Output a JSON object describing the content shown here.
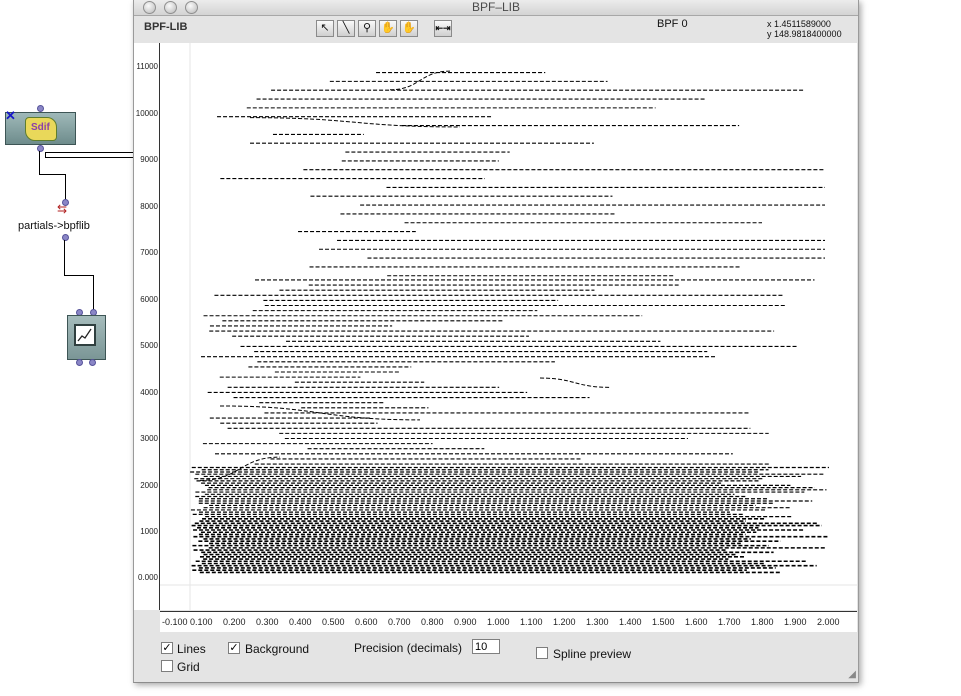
{
  "window": {
    "title": "BPF–LIB",
    "library_label": "BPF-LIB",
    "bpf_name": "BPF 0",
    "cursor_x": "x 1.4511589000",
    "cursor_y": "y 148.9818400000"
  },
  "toolbar": {
    "tools": [
      "arrow-select-icon",
      "pencil-draw-icon",
      "zoom-icon",
      "hand-move-icon",
      "hand-scroll-icon",
      "fit-width-icon"
    ]
  },
  "patch": {
    "box_label": "partials->bpflib",
    "sdif_icon_text": "Sdif"
  },
  "chart_data": {
    "type": "line",
    "description_free": true,
    "y_ticks": [
      "11000",
      "10000",
      "9000",
      "8000",
      "7000",
      "6000",
      "5000",
      "4000",
      "3000",
      "2000",
      "1000",
      "0.000"
    ],
    "x_ticks": [
      "-0.100",
      "0.100",
      "0.200",
      "0.300",
      "0.400",
      "0.500",
      "0.600",
      "0.700",
      "0.800",
      "0.900",
      "1.000",
      "1.100",
      "1.200",
      "1.300",
      "1.400",
      "1.500",
      "1.600",
      "1.700",
      "1.800",
      "1.900",
      "2.000"
    ],
    "xlim": [
      -0.1,
      2.0
    ],
    "ylim": [
      -50,
      11300
    ],
    "grid": false
  },
  "controls": {
    "lines_label": "Lines",
    "lines_checked": true,
    "background_label": "Background",
    "background_checked": true,
    "grid_label": "Grid",
    "grid_checked": false,
    "precision_label": "Precision (decimals)",
    "precision_value": "10",
    "spline_label": "Spline preview",
    "spline_checked": false
  }
}
